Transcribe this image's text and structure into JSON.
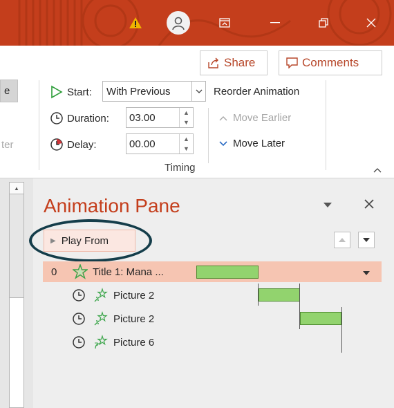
{
  "titlebar": {
    "icons": [
      "warning-icon",
      "account-icon",
      "ribbon-display-icon",
      "minimize-icon",
      "restore-icon",
      "close-icon"
    ],
    "colors": {
      "bar": "#c43e1c",
      "warning": "#f0b400"
    }
  },
  "ribbon": {
    "share_label": "Share",
    "comments_label": "Comments",
    "partial_left_btn": "e",
    "partial_left_faded": "ter",
    "timing": {
      "start_label": "Start:",
      "start_value": "With Previous",
      "duration_label": "Duration:",
      "duration_value": "03.00",
      "delay_label": "Delay:",
      "delay_value": "00.00",
      "group_label": "Timing"
    },
    "reorder": {
      "title": "Reorder Animation",
      "move_earlier": "Move Earlier",
      "move_later": "Move Later"
    }
  },
  "pane": {
    "title": "Animation Pane",
    "play_from_label": "Play From",
    "items": [
      {
        "number": "0",
        "name": "Title 1: Mana ...",
        "trigger": "on-click",
        "effect": "entrance-star-icon",
        "selected": true
      },
      {
        "number": "",
        "name": "Picture 2",
        "trigger": "after-previous-clock",
        "effect": "entrance-star-icon",
        "selected": false
      },
      {
        "number": "",
        "name": "Picture 2",
        "trigger": "after-previous-clock",
        "effect": "entrance-star-icon",
        "selected": false
      },
      {
        "number": "",
        "name": "Picture 6",
        "trigger": "after-previous-clock",
        "effect": "entrance-star-icon",
        "selected": false
      }
    ],
    "colors": {
      "title": "#c43e1c",
      "selected_row": "#f6c5b2",
      "timeline_bar": "#92d36e",
      "highlight_ring": "#143d4a"
    }
  }
}
